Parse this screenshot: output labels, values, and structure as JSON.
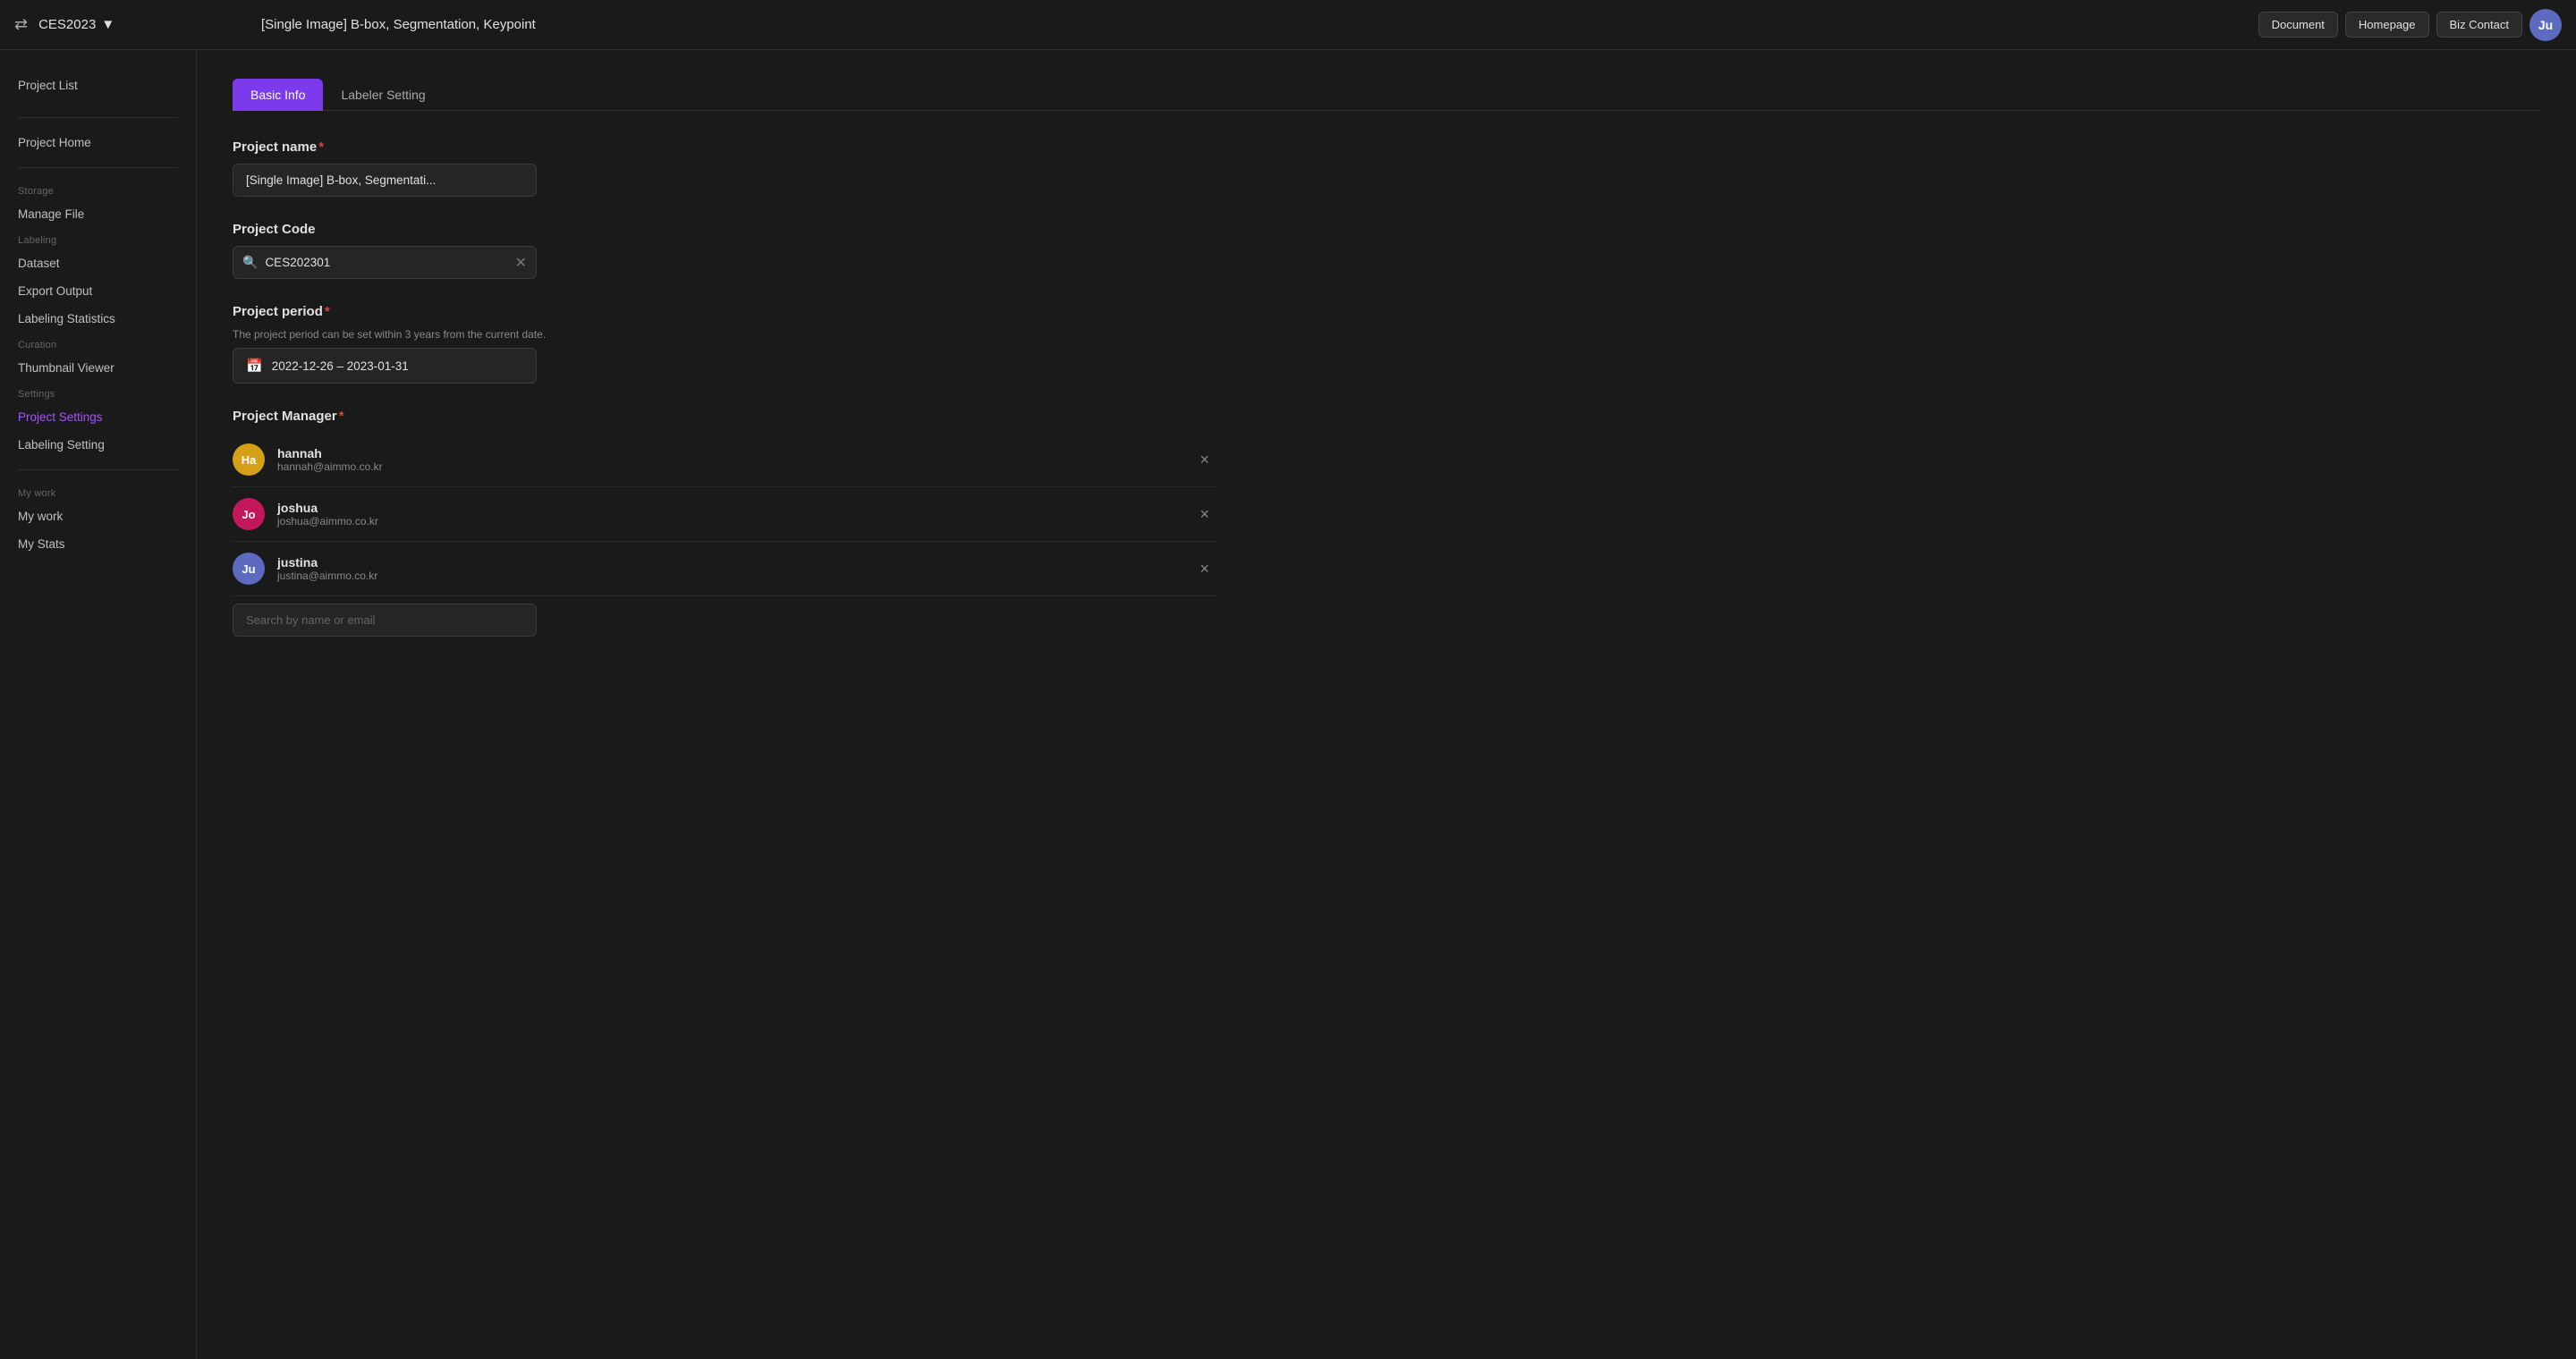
{
  "topbar": {
    "menu_icon": "≡",
    "project_name": "CES2023",
    "dropdown_icon": "▾",
    "page_title": "[Single Image] B-box, Segmentation, Keypoint",
    "buttons": [
      "Document",
      "Homepage",
      "Biz Contact"
    ],
    "avatar_text": "Ju"
  },
  "sidebar": {
    "project_list_label": "Project List",
    "project_home_label": "Project Home",
    "storage_section": "Storage",
    "manage_file_label": "Manage File",
    "labeling_section": "Labeling",
    "dataset_label": "Dataset",
    "export_output_label": "Export Output",
    "labeling_statistics_label": "Labeling Statistics",
    "curation_section": "Curation",
    "thumbnail_viewer_label": "Thumbnail Viewer",
    "settings_section": "Settings",
    "project_settings_label": "Project Settings",
    "labeling_setting_label": "Labeling Setting",
    "my_work_section": "My work",
    "my_work_label": "My work",
    "my_stats_label": "My Stats"
  },
  "tabs": {
    "basic_info": "Basic Info",
    "labeler_setting": "Labeler Setting"
  },
  "form": {
    "project_name_label": "Project name",
    "project_name_value": "[Single Image] B-box, Segmentati...",
    "project_code_label": "Project Code",
    "project_code_value": "CES202301",
    "project_period_label": "Project period",
    "project_period_hint": "The project period can be set within 3 years from the current date.",
    "project_period_value": "2022-12-26 – 2023-01-31",
    "project_manager_label": "Project Manager",
    "search_placeholder": "Search by name or email",
    "managers": [
      {
        "name": "hannah",
        "email": "hannah@aimmo.co.kr",
        "initials": "Ha",
        "color": "#d4a017"
      },
      {
        "name": "joshua",
        "email": "joshua@aimmo.co.kr",
        "initials": "Jo",
        "color": "#c2185b"
      },
      {
        "name": "justina",
        "email": "justina@aimmo.co.kr",
        "initials": "Ju",
        "color": "#5c6bc0"
      }
    ]
  }
}
